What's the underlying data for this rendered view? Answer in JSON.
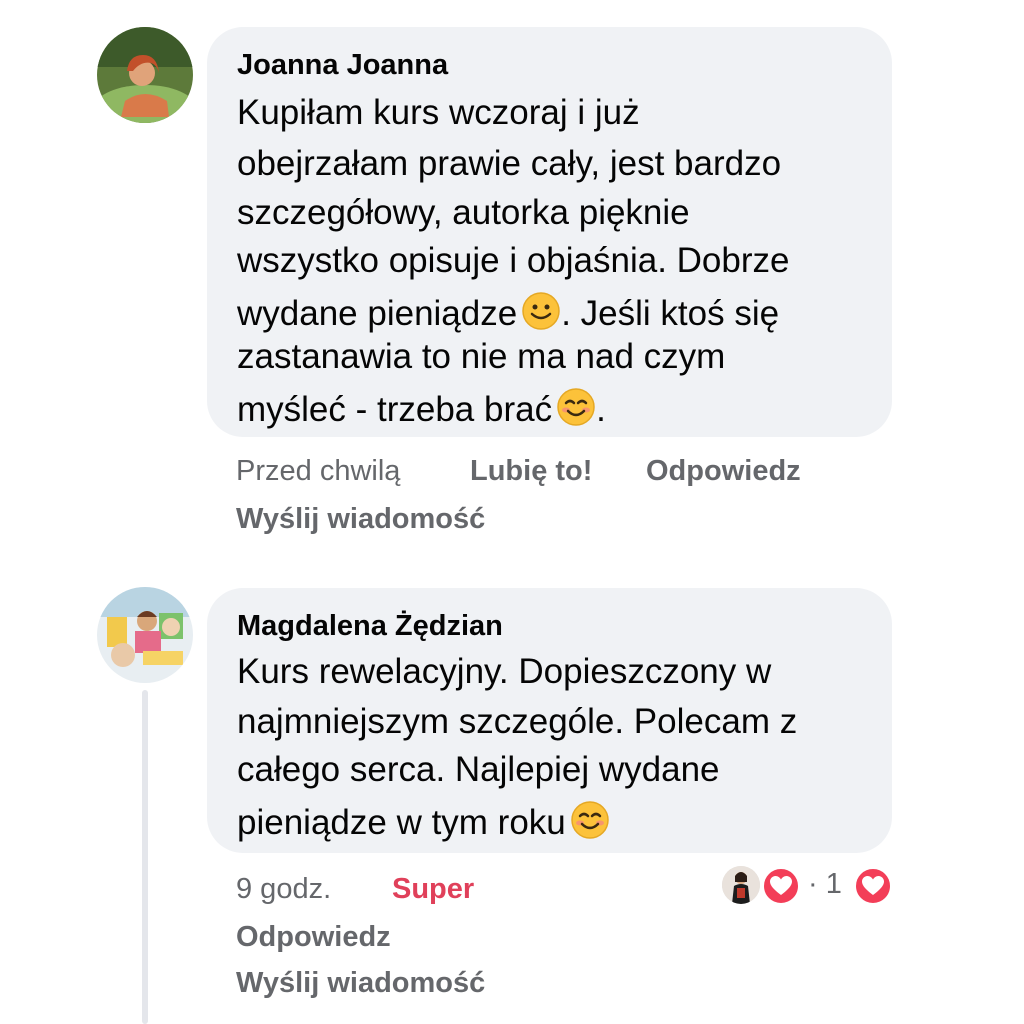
{
  "comments": [
    {
      "author": "Joanna Joanna",
      "lines": [
        "Kupiłam kurs wczoraj i już",
        "obejrzałam prawie cały, jest bardzo",
        "szczegółowy, autorka pięknie",
        "wszystko opisuje i objaśnia. Dobrze",
        "wydane pieniądze",
        ". Jeśli ktoś się",
        "zastanawia to nie ma nad czym",
        "myśleć - trzeba brać",
        "."
      ],
      "timestamp": "Przed chwilą",
      "like_label": "Lubię to!",
      "reply_label": "Odpowiedz",
      "message_label": "Wyślij wiadomość"
    },
    {
      "author": "Magdalena Żędzian",
      "lines": [
        "Kurs rewelacyjny. Dopieszczony w",
        "najmniejszym szczególe. Polecam z",
        "całego serca. Najlepiej wydane",
        "pieniądze w tym roku"
      ],
      "timestamp": "9 godz.",
      "reaction_label": "Super",
      "reply_label": "Odpowiedz",
      "message_label": "Wyślij wiadomość",
      "reaction_count": "· 1",
      "reaction_color": "#f33e58"
    }
  ],
  "icons": {
    "slight_smile": "slightly-smiling-face-emoji",
    "smile_blush": "smiling-face-with-smiling-eyes-emoji",
    "heart": "heart-icon"
  }
}
